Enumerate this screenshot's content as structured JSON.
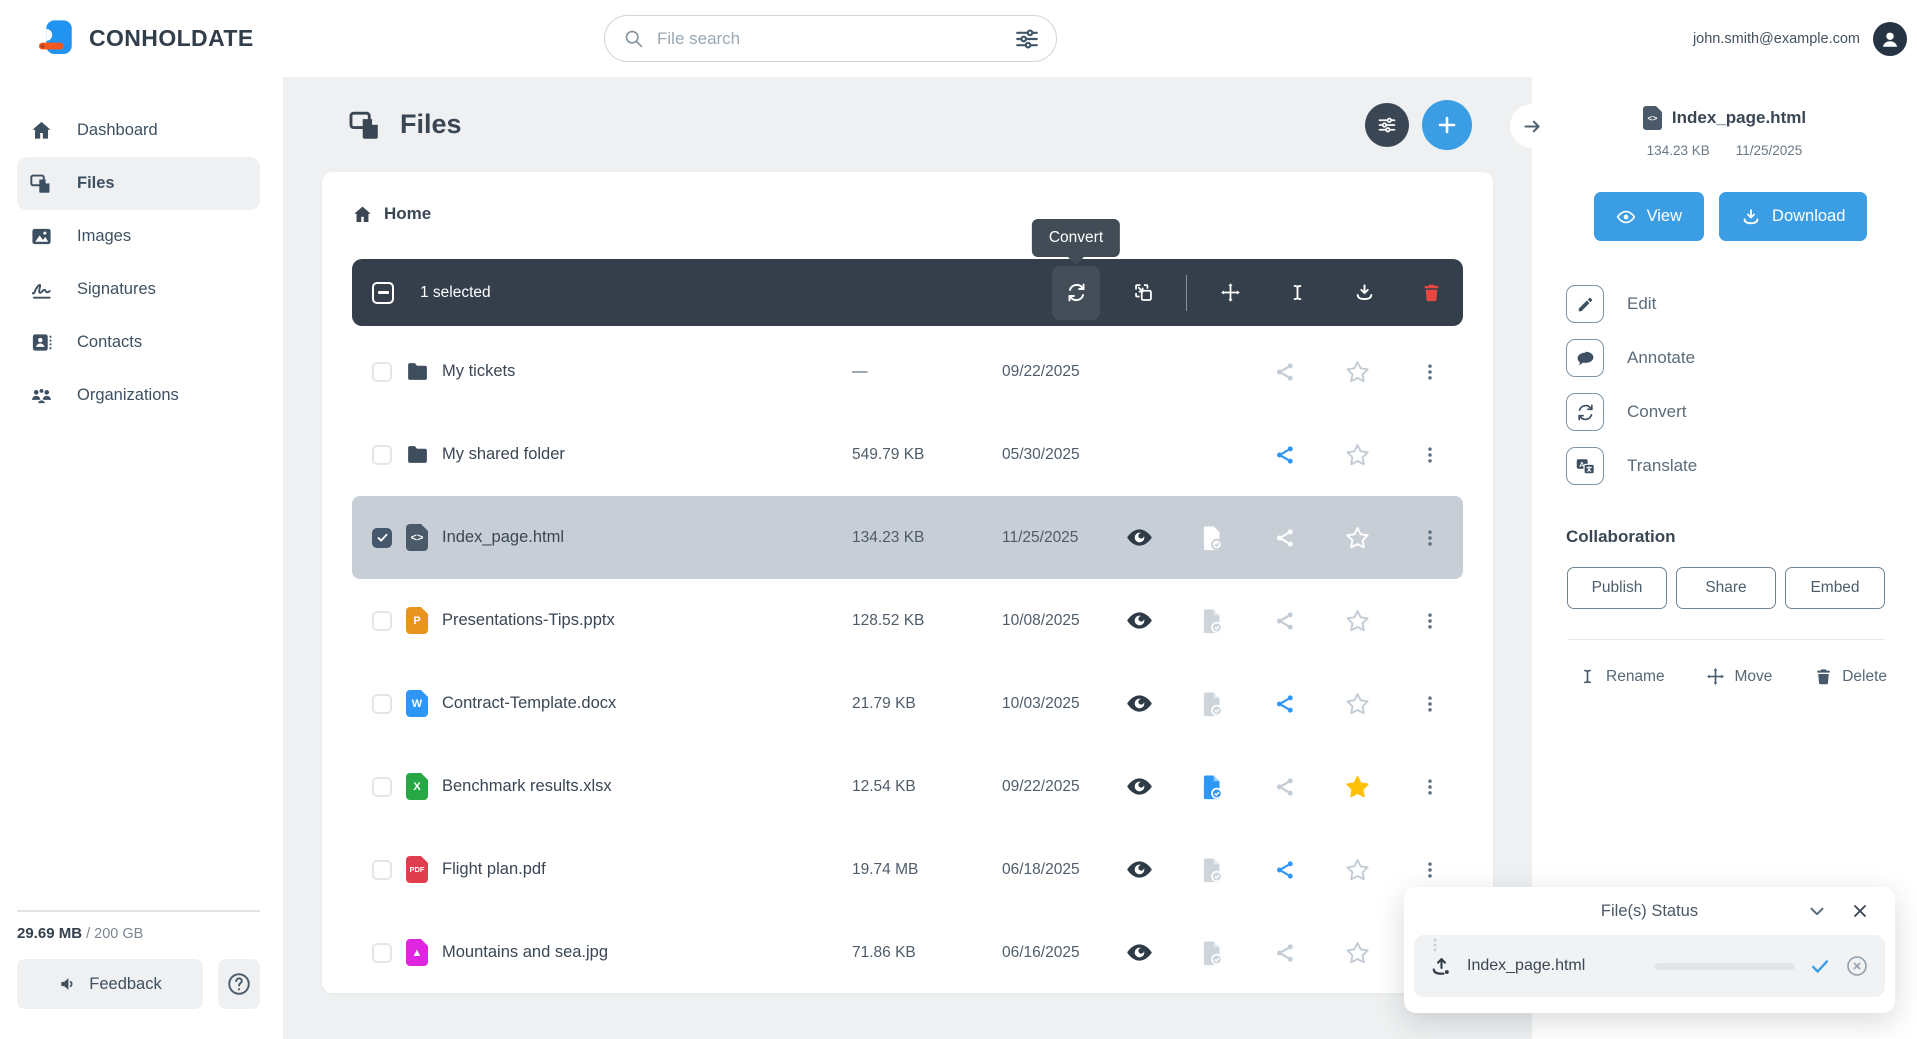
{
  "topbar": {
    "brand": "CONHOLDATE",
    "search_placeholder": "File search",
    "user_email": "john.smith@example.com"
  },
  "sidebar": {
    "items": [
      {
        "label": "Dashboard",
        "active": false
      },
      {
        "label": "Files",
        "active": true
      },
      {
        "label": "Images",
        "active": false
      },
      {
        "label": "Signatures",
        "active": false
      },
      {
        "label": "Contacts",
        "active": false
      },
      {
        "label": "Organizations",
        "active": false
      }
    ],
    "storage": {
      "used": "29.69 MB",
      "separator": "/",
      "total": "200 GB"
    },
    "feedback_label": "Feedback"
  },
  "main": {
    "title": "Files",
    "breadcrumb": "Home",
    "toolbar": {
      "selected_count": "1 selected",
      "tooltip": "Convert"
    },
    "files": [
      {
        "name": "My tickets",
        "type": "folder",
        "size": "—",
        "date": "09/22/2025",
        "selected": false,
        "eye": false,
        "doc": "none",
        "share": "gray",
        "star": "off"
      },
      {
        "name": "My shared folder",
        "type": "folder",
        "size": "549.79 KB",
        "date": "05/30/2025",
        "selected": false,
        "eye": false,
        "doc": "none",
        "share": "blue",
        "star": "off"
      },
      {
        "name": "Index_page.html",
        "type": "html",
        "size": "134.23 KB",
        "date": "11/25/2025",
        "selected": true,
        "eye": true,
        "doc": "white",
        "share": "white",
        "star": "white"
      },
      {
        "name": "Presentations-Tips.pptx",
        "type": "pptx",
        "size": "128.52 KB",
        "date": "10/08/2025",
        "selected": false,
        "eye": true,
        "doc": "gray",
        "share": "gray",
        "star": "off"
      },
      {
        "name": "Contract-Template.docx",
        "type": "docx",
        "size": "21.79 KB",
        "date": "10/03/2025",
        "selected": false,
        "eye": true,
        "doc": "gray",
        "share": "blue",
        "star": "off"
      },
      {
        "name": "Benchmark results.xlsx",
        "type": "xlsx",
        "size": "12.54 KB",
        "date": "09/22/2025",
        "selected": false,
        "eye": true,
        "doc": "blue",
        "share": "gray",
        "star": "on"
      },
      {
        "name": "Flight plan.pdf",
        "type": "pdf",
        "size": "19.74 MB",
        "date": "06/18/2025",
        "selected": false,
        "eye": true,
        "doc": "gray",
        "share": "blue",
        "star": "off"
      },
      {
        "name": "Mountains and sea.jpg",
        "type": "jpg",
        "size": "71.86 KB",
        "date": "06/16/2025",
        "selected": false,
        "eye": true,
        "doc": "gray",
        "share": "gray",
        "star": "off"
      }
    ]
  },
  "details": {
    "file_name": "Index_page.html",
    "file_size": "134.23 KB",
    "file_date": "11/25/2025",
    "view_label": "View",
    "download_label": "Download",
    "actions": [
      {
        "label": "Edit"
      },
      {
        "label": "Annotate"
      },
      {
        "label": "Convert"
      },
      {
        "label": "Translate"
      }
    ],
    "collaboration": {
      "heading": "Collaboration",
      "buttons": [
        {
          "label": "Publish"
        },
        {
          "label": "Share"
        },
        {
          "label": "Embed"
        }
      ]
    },
    "file_ops": [
      {
        "label": "Rename"
      },
      {
        "label": "Move"
      },
      {
        "label": "Delete"
      }
    ]
  },
  "status_panel": {
    "title": "File(s) Status",
    "items": [
      {
        "name": "Index_page.html",
        "progress": 100
      }
    ]
  },
  "file_type_glyphs": {
    "html": "<>",
    "pptx": "P",
    "docx": "W",
    "xlsx": "X",
    "pdf": "PDF",
    "jpg": "▲"
  },
  "colors": {
    "accent": "#3b9de4",
    "toolbar_bg": "#343f4b",
    "selected_row_bg": "#c8ced6",
    "star_active": "#ffc107",
    "delete_red": "#e8473f",
    "share_active": "#2e96f5",
    "file_type_colors": {
      "folder": "#3f4e5d",
      "html": "#4a5a68",
      "pptx": "#e8941e",
      "docx": "#2e96f5",
      "xlsx": "#28a745",
      "pdf": "#e03e4e",
      "jpg": "#df25df"
    }
  }
}
